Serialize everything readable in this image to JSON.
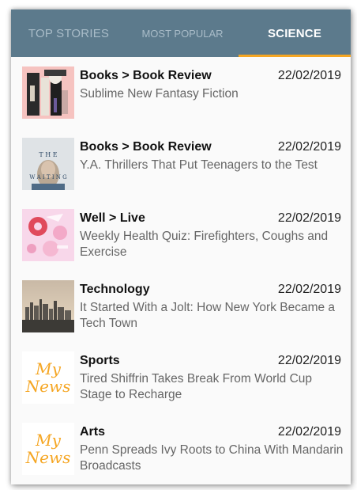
{
  "tabs": [
    {
      "label": "TOP STORIES",
      "selected": false
    },
    {
      "label": "MOST POPULAR",
      "selected": false
    },
    {
      "label": "SCIENCE",
      "selected": true
    }
  ],
  "colors": {
    "tabbar": "#5c7a8c",
    "indicator": "#f5a623",
    "placeholder_text": "#f5a623"
  },
  "placeholder": {
    "line1": "My",
    "line2": "News"
  },
  "articles": [
    {
      "section": "Books > Book Review",
      "date": "22/02/2019",
      "headline": "Sublime New Fantasy Fiction",
      "thumbnail": "fantasy-art-image"
    },
    {
      "section": "Books > Book Review",
      "date": "22/02/2019",
      "headline": "Y.A. Thrillers That Put Teenagers to the Test",
      "thumbnail": "book-cover-the-waiting-image",
      "thumb_text_top": "T H E",
      "thumb_text_bottom": "W A I T I N G"
    },
    {
      "section": "Well > Live",
      "date": "22/02/2019",
      "headline": "Weekly Health Quiz: Firefighters, Coughs and Exercise",
      "thumbnail": "pink-illustration-image"
    },
    {
      "section": "Technology",
      "date": "22/02/2019",
      "headline": "It Started With a Jolt: How New York Became a Tech Town",
      "thumbnail": "city-skyline-image"
    },
    {
      "section": "Sports",
      "date": "22/02/2019",
      "headline": "Tired Shiffrin Takes Break From World Cup Stage to Recharge",
      "thumbnail": "my-news-placeholder"
    },
    {
      "section": "Arts",
      "date": "22/02/2019",
      "headline": "Penn Spreads Ivy Roots to China With Mandarin Broadcasts",
      "thumbnail": "my-news-placeholder"
    }
  ]
}
